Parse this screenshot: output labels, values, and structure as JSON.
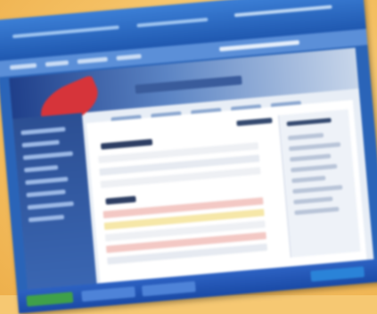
{
  "colors": {
    "background": "#f6c872",
    "titlebar": "#2a64b8",
    "banner_dark": "#1f3f8a",
    "banner_accent": "#d6343a",
    "sidebar": "#2c4f93",
    "content": "#ffffff",
    "highlight_row_red": "#f3c8c4",
    "highlight_row_yellow": "#f6e7a8"
  },
  "icons": {
    "logo": "swoosh-logo-icon"
  }
}
